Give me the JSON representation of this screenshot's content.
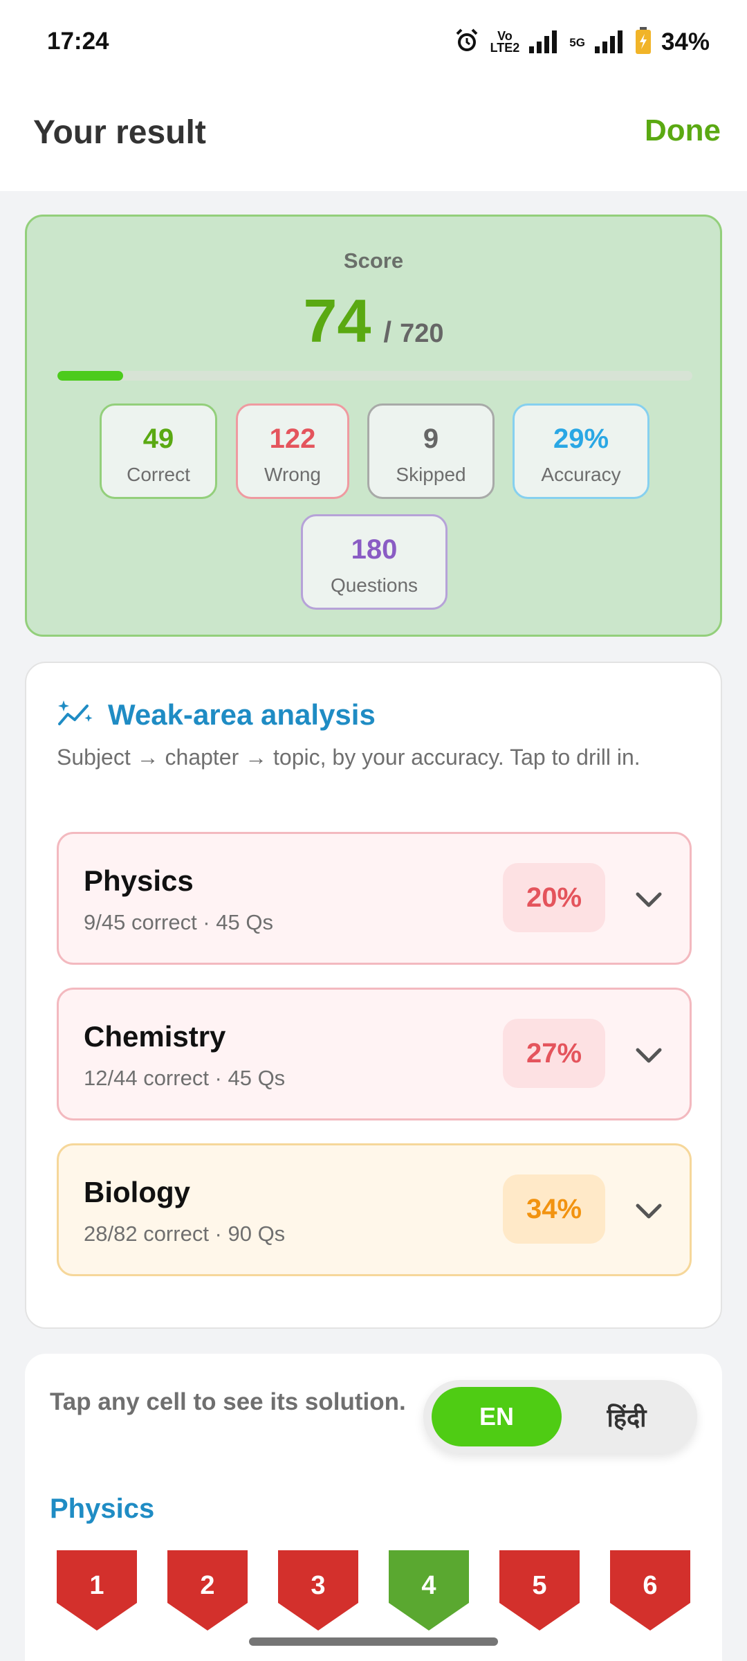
{
  "status_bar": {
    "time": "17:24",
    "volte_top": "Vo",
    "volte_bottom": "LTE2",
    "network": "5G",
    "battery": "34%"
  },
  "header": {
    "title": "Your result",
    "done_label": "Done"
  },
  "score": {
    "label": "Score",
    "value": "74",
    "separator": "/",
    "total": "720",
    "progress_fraction": 0.103,
    "stats": [
      {
        "value": "49",
        "label": "Correct",
        "color": "#5aa912",
        "border": "#93cf7b"
      },
      {
        "value": "122",
        "label": "Wrong",
        "color": "#e4545c",
        "border": "#ef9aa0"
      },
      {
        "value": "9",
        "label": "Skipped",
        "color": "#666666",
        "border": "#a8aaa8"
      },
      {
        "value": "29%",
        "label": "Accuracy",
        "color": "#2aa7e4",
        "border": "#86d0ef"
      },
      {
        "value": "180",
        "label": "Questions",
        "color": "#8a5cc4",
        "border": "#b6a2d8"
      }
    ]
  },
  "weak_area": {
    "title": "Weak-area analysis",
    "description": "Subject → chapter → topic, by your accuracy. Tap to drill in.",
    "subjects": [
      {
        "name": "Physics",
        "meta": "9/45 correct · 45 Qs",
        "percent": "20%"
      },
      {
        "name": "Chemistry",
        "meta": "12/44 correct · 45 Qs",
        "percent": "27%"
      },
      {
        "name": "Biology",
        "meta": "28/82 correct · 90 Qs",
        "percent": "34%"
      }
    ],
    "colors": {
      "weak_bg": "#fff3f4",
      "weak_border": "#f3b9bf",
      "weak_pill": "#fde1e3",
      "weak_text": "#e4545c",
      "mid_bg": "#fff7ea",
      "mid_border": "#f6d79a",
      "mid_pill": "#ffe9c8",
      "mid_text": "#f29310"
    }
  },
  "question_grid": {
    "hint": "Tap any cell to see its solution.",
    "lang_en": "EN",
    "lang_hi": "हिंदी",
    "subject": "Physics",
    "cells": [
      {
        "number": "1",
        "status": "wrong"
      },
      {
        "number": "2",
        "status": "wrong"
      },
      {
        "number": "3",
        "status": "wrong"
      },
      {
        "number": "4",
        "status": "correct"
      },
      {
        "number": "5",
        "status": "wrong"
      },
      {
        "number": "6",
        "status": "wrong"
      }
    ],
    "colors": {
      "wrong": "#d3302c",
      "correct": "#5aa830"
    }
  }
}
